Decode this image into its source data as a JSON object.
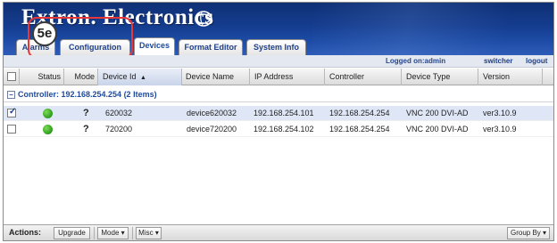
{
  "header": {
    "logo_text": "Extron. Electronics"
  },
  "tabs": [
    {
      "label": "Alarms"
    },
    {
      "label": "Configuration"
    },
    {
      "label": "Devices"
    },
    {
      "label": "Format Editor"
    },
    {
      "label": "System Info"
    }
  ],
  "callout": {
    "label": "5e"
  },
  "loginbar": {
    "logged_on": "Logged on:admin",
    "switcher": "switcher",
    "logout": "logout"
  },
  "columns": {
    "status": "Status",
    "mode": "Mode",
    "device_id": "Device Id",
    "device_name": "Device Name",
    "ip_address": "IP Address",
    "controller": "Controller",
    "device_type": "Device Type",
    "version": "Version"
  },
  "group": {
    "label": "Controller: 192.168.254.254 (2 Items)"
  },
  "rows": [
    {
      "checked": true,
      "status_color": "#3da82a",
      "mode": "?",
      "device_id": "620032",
      "device_name": "device620032",
      "ip": "192.168.254.101",
      "controller": "192.168.254.254",
      "type": "VNC 200 DVI-AD",
      "version": "ver3.10.9"
    },
    {
      "checked": false,
      "status_color": "#3da82a",
      "mode": "?",
      "device_id": "720200",
      "device_name": "device720200",
      "ip": "192.168.254.102",
      "controller": "192.168.254.254",
      "type": "VNC 200 DVI-AD",
      "version": "ver3.10.9"
    }
  ],
  "footer": {
    "actions_label": "Actions:",
    "upgrade": "Upgrade",
    "mode": "Mode ▾",
    "misc": "Misc ▾",
    "group_by": "Group By ▾"
  },
  "colors": {
    "header_blue": "#153d8f",
    "link_blue": "#1f3f87",
    "status_green": "#3da82a",
    "callout_red": "#e63838"
  }
}
